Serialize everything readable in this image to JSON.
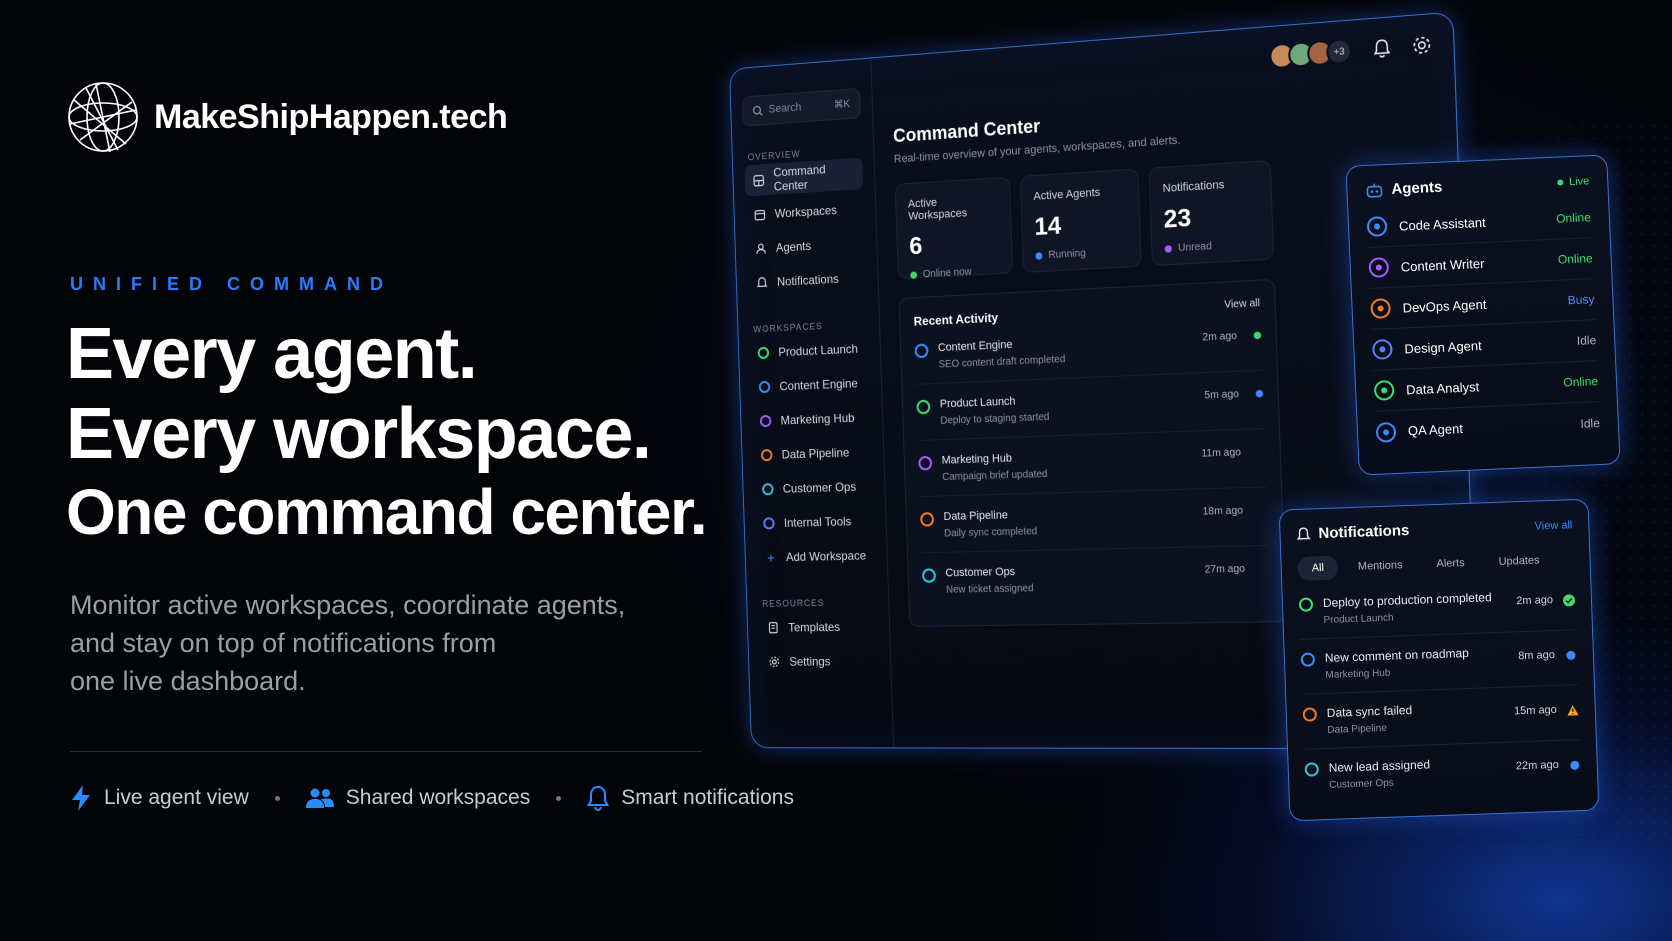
{
  "brand": {
    "name": "MakeShipHappen.tech"
  },
  "hero": {
    "eyebrow": "UNIFIED COMMAND",
    "line1": "Every agent.",
    "line2": "Every workspace.",
    "line3": "One command center.",
    "sub1": "Monitor active workspaces, coordinate agents,",
    "sub2": "and stay on top of notifications from",
    "sub3": "one live dashboard."
  },
  "features": [
    {
      "label": "Live agent view",
      "icon": "lightning-icon"
    },
    {
      "label": "Shared workspaces",
      "icon": "users-icon"
    },
    {
      "label": "Smart notifications",
      "icon": "bell-icon"
    }
  ],
  "colors": {
    "accent": "#2a7bff",
    "online": "#3ddc6b",
    "busy": "#4d8cff",
    "warn": "#f5a623"
  },
  "sidebar": {
    "search_placeholder": "Search",
    "search_shortcut": "⌘K",
    "overview_label": "OVERVIEW",
    "overview": [
      "Command Center",
      "Workspaces",
      "Agents",
      "Notifications"
    ],
    "workspaces_label": "WORKSPACES",
    "workspaces": [
      {
        "name": "Product Launch",
        "color": "#3ddc6b"
      },
      {
        "name": "Content Engine",
        "color": "#3a8bff"
      },
      {
        "name": "Marketing Hub",
        "color": "#a45cff"
      },
      {
        "name": "Data Pipeline",
        "color": "#f07a2a"
      },
      {
        "name": "Customer Ops",
        "color": "#2cc6d6"
      },
      {
        "name": "Internal Tools",
        "color": "#5a7dff"
      }
    ],
    "add_workspace": "Add Workspace",
    "resources_label": "RESOURCES",
    "resources": [
      "Templates",
      "Settings"
    ]
  },
  "topbar": {
    "more_count": "+3"
  },
  "dashboard": {
    "title": "Command Center",
    "subtitle": "Real-time overview of your agents, workspaces, and alerts.",
    "stats": [
      {
        "label": "Active Workspaces",
        "value": "6",
        "foot": "Online now",
        "color": "#3ddc6b"
      },
      {
        "label": "Active Agents",
        "value": "14",
        "foot": "Running",
        "color": "#3a8bff"
      },
      {
        "label": "Notifications",
        "value": "23",
        "foot": "Unread",
        "color": "#a45cff"
      }
    ],
    "activity": {
      "title": "Recent Activity",
      "view_all": "View all",
      "items": [
        {
          "title": "Content Engine",
          "sub": "SEO content draft completed",
          "time": "2m ago",
          "color": "#3a8bff",
          "dot": "#3ddc6b"
        },
        {
          "title": "Product Launch",
          "sub": "Deploy to staging started",
          "time": "5m ago",
          "color": "#3ddc6b",
          "dot": "#3a8bff"
        },
        {
          "title": "Marketing Hub",
          "sub": "Campaign brief updated",
          "time": "11m ago",
          "color": "#a45cff",
          "dot": ""
        },
        {
          "title": "Data Pipeline",
          "sub": "Daily sync completed",
          "time": "18m ago",
          "color": "#f07a2a",
          "dot": ""
        },
        {
          "title": "Customer Ops",
          "sub": "New ticket assigned",
          "time": "27m ago",
          "color": "#2cc6d6",
          "dot": ""
        }
      ]
    }
  },
  "agents": {
    "title": "Agents",
    "live": "Live",
    "items": [
      {
        "name": "Code Assistant",
        "status": "Online",
        "color": "#3a8bff",
        "status_color": "#3ddc6b"
      },
      {
        "name": "Content Writer",
        "status": "Online",
        "color": "#a45cff",
        "status_color": "#3ddc6b"
      },
      {
        "name": "DevOps Agent",
        "status": "Busy",
        "color": "#f07a2a",
        "status_color": "#4d8cff"
      },
      {
        "name": "Design Agent",
        "status": "Idle",
        "color": "#5a7dff",
        "status_color": "#aab1c0"
      },
      {
        "name": "Data Analyst",
        "status": "Online",
        "color": "#3ddc6b",
        "status_color": "#3ddc6b"
      },
      {
        "name": "QA Agent",
        "status": "Idle",
        "color": "#3a8bff",
        "status_color": "#aab1c0"
      }
    ]
  },
  "notifications": {
    "title": "Notifications",
    "view_all": "View all",
    "tabs": [
      "All",
      "Mentions",
      "Alerts",
      "Updates"
    ],
    "items": [
      {
        "title": "Deploy to production completed",
        "sub": "Product Launch",
        "time": "2m ago",
        "color": "#3ddc6b",
        "status": "check"
      },
      {
        "title": "New comment on roadmap",
        "sub": "Marketing Hub",
        "time": "8m ago",
        "color": "#3a8bff",
        "status": "dot"
      },
      {
        "title": "Data sync failed",
        "sub": "Data Pipeline",
        "time": "15m ago",
        "color": "#f07a2a",
        "status": "warn"
      },
      {
        "title": "New lead assigned",
        "sub": "Customer Ops",
        "time": "22m ago",
        "color": "#2cc6d6",
        "status": "dot"
      }
    ]
  }
}
